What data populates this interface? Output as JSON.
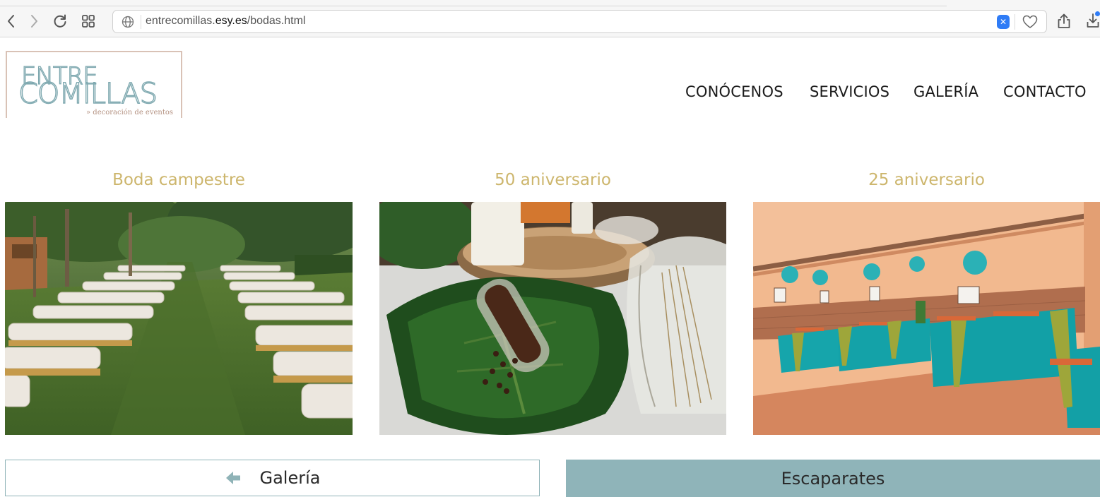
{
  "browser": {
    "url_prefix": "entrecomillas.",
    "url_domain": "esy.es",
    "url_path": "/bodas.html",
    "ext_badge": "✕"
  },
  "logo": {
    "line1": "ENTRE",
    "line2": "COMILLAS",
    "tagline": "» decoración de eventos"
  },
  "nav": {
    "items": [
      "CONÓCENOS",
      "SERVICIOS",
      "GALERÍA",
      "CONTACTO"
    ]
  },
  "gallery": {
    "cards": [
      {
        "title": "Boda campestre"
      },
      {
        "title": "50 aniversario"
      },
      {
        "title": "25 aniversario"
      }
    ]
  },
  "buttons": {
    "prev_label": "Galería",
    "next_label": "Escaparates"
  },
  "colors": {
    "title_gold": "#cdb66d",
    "accent_teal": "#8fb4b9",
    "logo_teal": "#7fa9b0",
    "logo_rose": "#d9c2b6"
  }
}
